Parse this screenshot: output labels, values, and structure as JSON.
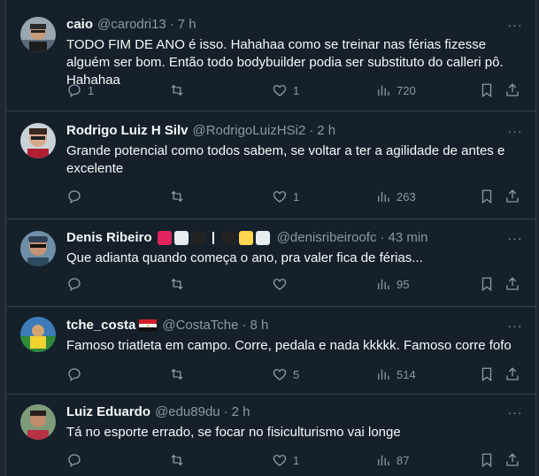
{
  "tweets": [
    {
      "name": "caio",
      "handle": "@carodri13",
      "time": "7 h",
      "text": "TODO FIM DE ANO é isso. Hahahaa como se treinar nas férias fizesse alguém ser bom. Então todo bodybuilder podia ser substituto do calleri pô. Hahahaa",
      "replies": "1",
      "retweets": "",
      "likes": "1",
      "views": "720"
    },
    {
      "name": "Rodrigo Luiz H Silv",
      "handle": "@RodrigoLuizHSi2",
      "time": "2 h",
      "text": "Grande potencial como todos sabem, se voltar a ter a agilidade de antes e excelente",
      "replies": "",
      "retweets": "",
      "likes": "1",
      "views": "263"
    },
    {
      "name": "Denis Ribeiro",
      "handle": "@denisribeiroofc",
      "time": "43 min",
      "text": "Que adianta quando começa o ano, pra valer fica de férias...",
      "replies": "",
      "retweets": "",
      "likes": "",
      "views": "95"
    },
    {
      "name": "tche_costa",
      "handle": "@CostaTche",
      "time": "8 h",
      "text": "Famoso triatleta em campo. Corre, pedala e nada kkkkk. Famoso corre fofo",
      "replies": "",
      "retweets": "",
      "likes": "5",
      "views": "514"
    },
    {
      "name": "Luiz Eduardo",
      "handle": "@edu89du",
      "time": "2 h",
      "text": "Tá no esporte errado, se focar no fisiculturismo vai longe",
      "replies": "",
      "retweets": "",
      "likes": "1",
      "views": "87"
    }
  ],
  "separator": "·",
  "more_glyph": "···",
  "colors": {
    "background": "#15202b",
    "border": "#38444d",
    "text_primary": "#f7f9f9",
    "text_secondary": "#8b98a5",
    "badge_red": "#e0245e",
    "badge_white": "#e6ecf0",
    "badge_black": "#222222",
    "badge_yellow": "#ffd54f"
  }
}
